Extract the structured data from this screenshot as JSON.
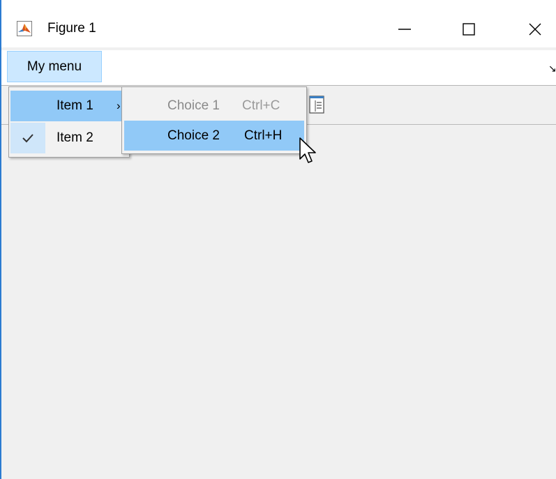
{
  "window": {
    "title": "Figure 1",
    "minimize_glyph": "—",
    "maximize_glyph": "☐",
    "close_glyph": "✕"
  },
  "menubar": {
    "menu_label": "My menu",
    "dock_glyph": "↘"
  },
  "dropdown": {
    "items": [
      {
        "label": "Item 1",
        "submenu_arrow": "›",
        "checked": false,
        "highlighted": true
      },
      {
        "label": "Item 2",
        "check_glyph": "✔",
        "checked": true,
        "highlighted": false
      }
    ]
  },
  "submenu": {
    "items": [
      {
        "label": "Choice 1",
        "shortcut": "Ctrl+C",
        "enabled": false
      },
      {
        "label": "Choice 2",
        "shortcut": "Ctrl+H",
        "enabled": true,
        "highlighted": true
      }
    ]
  },
  "colors": {
    "window_border": "#2b7bd1",
    "menu_highlight": "#91c9f7",
    "menubar_active": "#cce8ff",
    "matlab_icon": "#d9541e"
  },
  "icons": {
    "app": "matlab-logo-icon",
    "toolbar": "property-inspector-icon",
    "cursor": "mouse-pointer-icon"
  }
}
